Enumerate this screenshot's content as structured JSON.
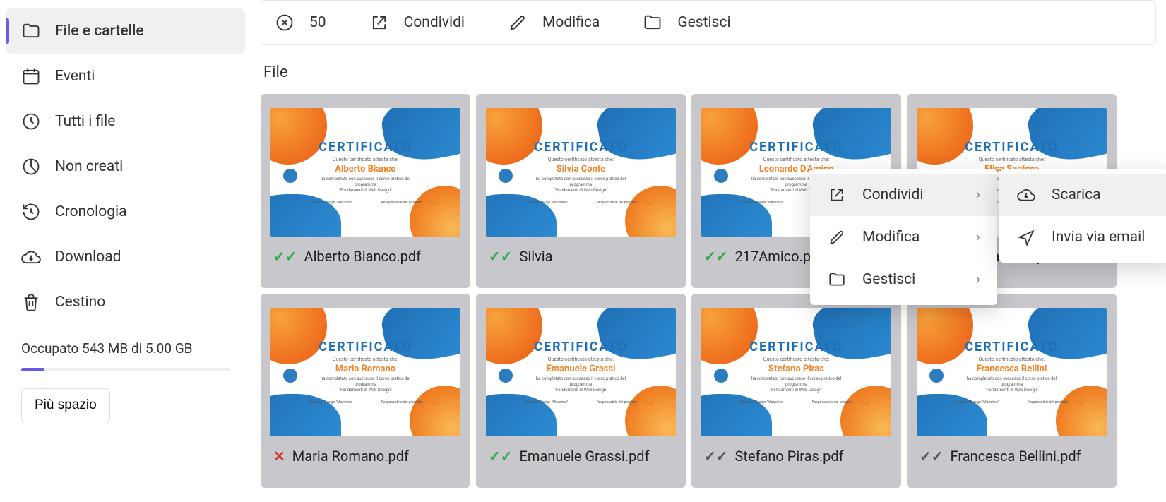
{
  "sidebar": {
    "items": [
      {
        "label": "File e cartelle"
      },
      {
        "label": "Eventi"
      },
      {
        "label": "Tutti i file"
      },
      {
        "label": "Non creati"
      },
      {
        "label": "Cronologia"
      },
      {
        "label": "Download"
      },
      {
        "label": "Cestino"
      }
    ],
    "storage_text": "Occupato 543 MB di 5.00 GB",
    "more_space": "Più spazio"
  },
  "toolbar": {
    "count": "50",
    "share": "Condividi",
    "edit": "Modifica",
    "manage": "Gestisci"
  },
  "section_title": "File",
  "context_menu": {
    "share": "Condividi",
    "edit": "Modifica",
    "manage": "Gestisci",
    "download": "Scarica",
    "email": "Invia via email"
  },
  "cert_common": {
    "heading": "CERTIFICATO",
    "subtitle": "Questo certificato attesta che:",
    "body1": "ha completato con successo il corso pratico del programma",
    "body2": "\"Fondamenti di Web Design\"",
    "foot_left": "Scuola di Design \"Massimo\"",
    "foot_right": "Responsabile del progetto"
  },
  "files": [
    {
      "person": "Alberto Bianco",
      "filename": "Alberto Bianco.pdf",
      "status": "ok"
    },
    {
      "person": "Silvia Conte",
      "filename": "Silvia",
      "status": "ok"
    },
    {
      "person": "Leonardo D'Amico",
      "filename": "217Amico.pdf",
      "status": "ok"
    },
    {
      "person": "Elisa Santoro",
      "filename": "Elisa Santoro.pdf",
      "status": "ok"
    },
    {
      "person": "Maria Romano",
      "filename": "Maria Romano.pdf",
      "status": "err"
    },
    {
      "person": "Emanuele Grassi",
      "filename": "Emanuele Grassi.pdf",
      "status": "ok"
    },
    {
      "person": "Stefano Piras",
      "filename": "Stefano Piras.pdf",
      "status": "gray"
    },
    {
      "person": "Francesca Bellini",
      "filename": "Francesca Bellini.pdf",
      "status": "gray"
    }
  ]
}
